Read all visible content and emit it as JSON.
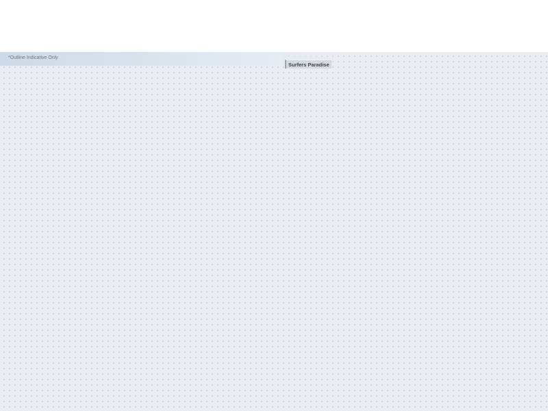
{
  "map": {
    "disclaimer": "*Outline Indicative Only",
    "place_label": "Surfers Paradise"
  },
  "colors": {
    "background": "#e9eef2",
    "dot": "#9aa6ad",
    "header_band": "#cdd9e6",
    "label_bg": "#d6dadd",
    "label_accent": "#8fa4b4"
  }
}
